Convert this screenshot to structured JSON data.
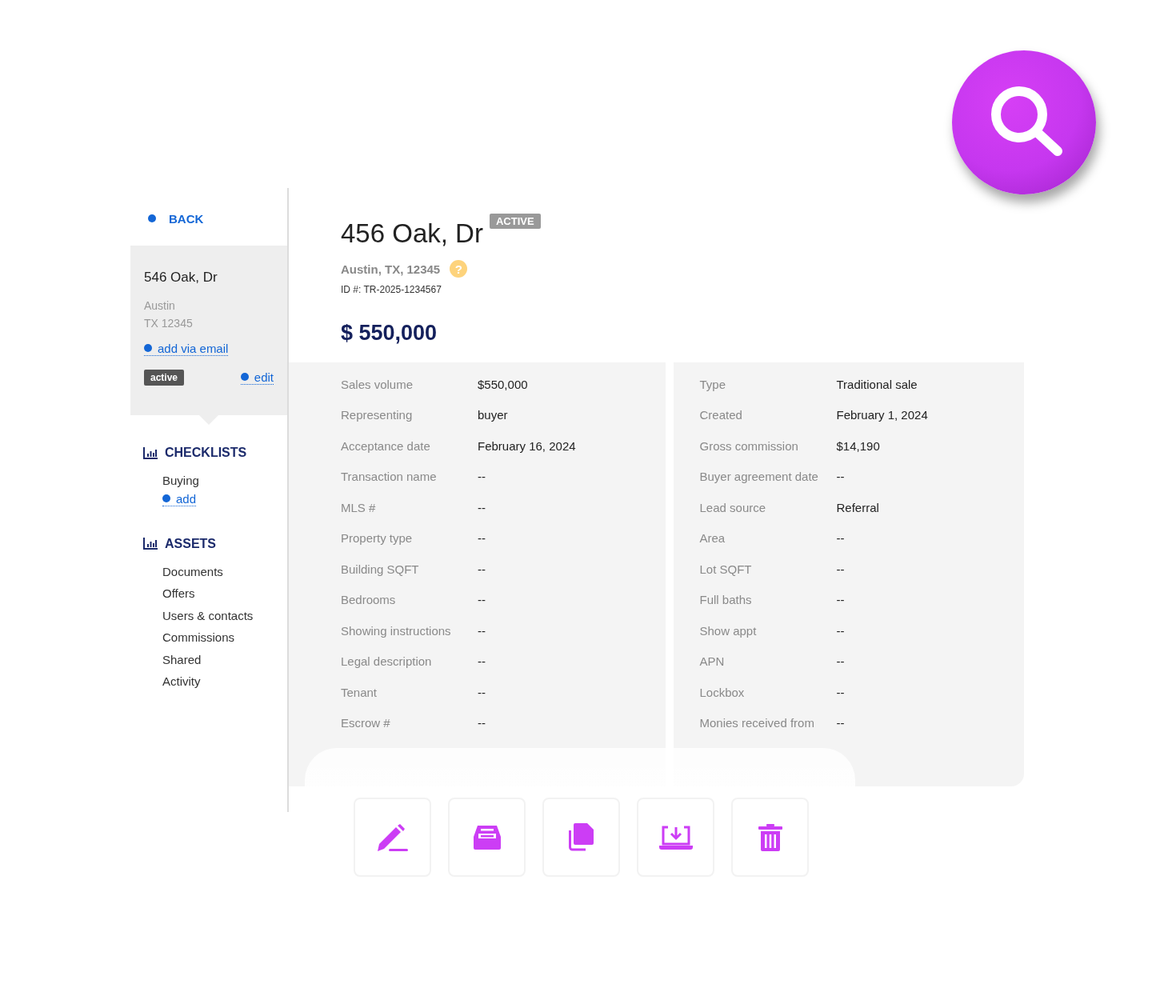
{
  "sidebar": {
    "back": "BACK",
    "card": {
      "title": "546 Oak, Dr",
      "city": "Austin",
      "state_zip": "TX 12345",
      "email_link": "add via email",
      "status": "active",
      "edit_link": "edit"
    },
    "sections": [
      {
        "title": "CHECKLISTS",
        "items": [
          "Buying"
        ],
        "add_link": "add"
      },
      {
        "title": "ASSETS",
        "items": [
          "Documents",
          "Offers",
          "Users & contacts",
          "Commissions",
          "Shared",
          "Activity"
        ]
      }
    ]
  },
  "header": {
    "title": "456 Oak, Dr",
    "status": "ACTIVE",
    "address": "Austin, TX, 12345",
    "help": "?",
    "id": "ID #: TR-2025-1234567",
    "price": "$ 550,000"
  },
  "details_left": [
    {
      "label": "Sales volume",
      "value": "$550,000"
    },
    {
      "label": "Representing",
      "value": "buyer"
    },
    {
      "label": "Acceptance date",
      "value": "February 16, 2024"
    },
    {
      "label": "Transaction name",
      "value": "--"
    },
    {
      "label": "MLS #",
      "value": "--"
    },
    {
      "label": "Property type",
      "value": "--"
    },
    {
      "label": "Building SQFT",
      "value": "--"
    },
    {
      "label": "Bedrooms",
      "value": "--"
    },
    {
      "label": "Showing instructions",
      "value": "--"
    },
    {
      "label": "Legal description",
      "value": "--"
    },
    {
      "label": "Tenant",
      "value": "--"
    },
    {
      "label": "Escrow #",
      "value": "--"
    }
  ],
  "details_right": [
    {
      "label": "Type",
      "value": "Traditional sale"
    },
    {
      "label": "Created",
      "value": "February 1, 2024"
    },
    {
      "label": "Gross commission",
      "value": "$14,190"
    },
    {
      "label": "Buyer agreement date",
      "value": "--"
    },
    {
      "label": "Lead source",
      "value": "Referral"
    },
    {
      "label": "Area",
      "value": "--"
    },
    {
      "label": "Lot SQFT",
      "value": "--"
    },
    {
      "label": "Full baths",
      "value": "--"
    },
    {
      "label": "Show appt",
      "value": "--"
    },
    {
      "label": "APN",
      "value": "--"
    },
    {
      "label": "Lockbox",
      "value": "--"
    },
    {
      "label": "Monies received from",
      "value": "--"
    }
  ],
  "actions": [
    {
      "kind": "edit"
    },
    {
      "kind": "archive"
    },
    {
      "kind": "copy"
    },
    {
      "kind": "download"
    },
    {
      "kind": "delete"
    }
  ]
}
